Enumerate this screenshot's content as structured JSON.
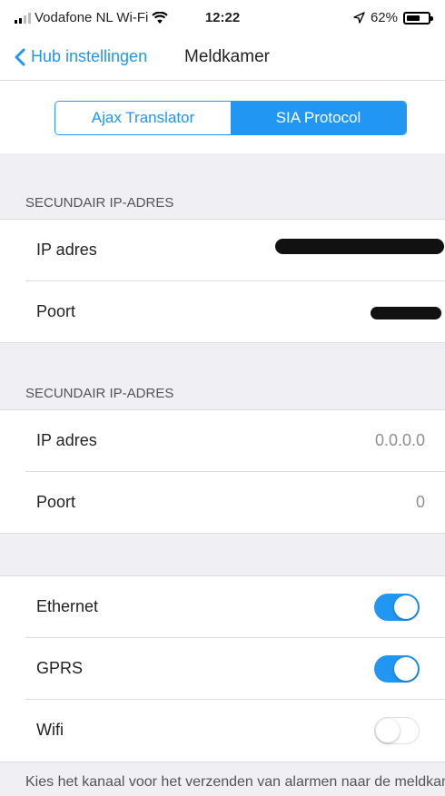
{
  "status_bar": {
    "carrier": "Vodafone NL Wi-Fi",
    "time": "12:22",
    "battery_percent": "62%",
    "battery_level": 0.62,
    "icons": [
      "signal-icon",
      "wifi-icon",
      "location-icon",
      "battery-icon"
    ]
  },
  "nav": {
    "back_label": "Hub instellingen",
    "title": "Meldkamer"
  },
  "tabs": {
    "items": [
      {
        "label": "Ajax Translator",
        "active": false
      },
      {
        "label": "SIA Protocol",
        "active": true
      }
    ]
  },
  "sections": [
    {
      "header": "SECUNDAIR IP-ADRES",
      "rows": [
        {
          "label": "IP adres",
          "value": ""
        },
        {
          "label": "Poort",
          "value": ""
        }
      ]
    },
    {
      "header": "SECUNDAIR IP-ADRES",
      "rows": [
        {
          "label": "IP adres",
          "value": "0.0.0.0"
        },
        {
          "label": "Poort",
          "value": "0"
        }
      ]
    }
  ],
  "channels": [
    {
      "label": "Ethernet",
      "enabled": true
    },
    {
      "label": "GPRS",
      "enabled": true
    },
    {
      "label": "Wifi",
      "enabled": false
    }
  ],
  "footer_note": "Kies het kanaal voor het verzenden van alarmen naar de meldkamer",
  "colors": {
    "accent": "#2196f3",
    "group_background": "#efeff4",
    "separator": "#dcdcdc"
  }
}
